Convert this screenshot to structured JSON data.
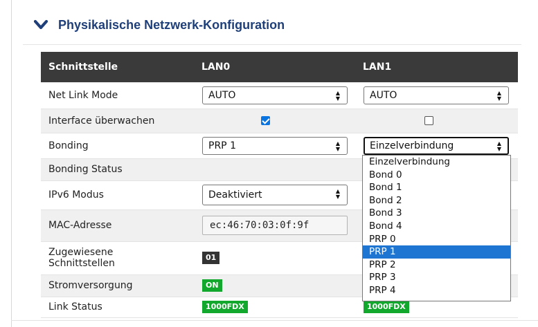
{
  "section": {
    "title": "Physikalische Netzwerk-Konfiguration"
  },
  "table": {
    "headers": [
      "Schnittstelle",
      "LAN0",
      "LAN1"
    ],
    "rows": {
      "net_link_mode": {
        "label": "Net Link Mode",
        "lan0": "AUTO",
        "lan1": "AUTO"
      },
      "interface_ueberwachen": {
        "label": "Interface überwachen",
        "lan0_checked": true,
        "lan1_checked": false
      },
      "bonding": {
        "label": "Bonding",
        "lan0": "PRP 1",
        "lan1": "Einzelverbindung"
      },
      "bonding_status": {
        "label": "Bonding Status"
      },
      "ipv6_modus": {
        "label": "IPv6 Modus",
        "lan0": "Deaktiviert"
      },
      "mac_adresse": {
        "label": "MAC-Adresse",
        "lan0": "ec:46:70:03:0f:9f"
      },
      "zugewiesene": {
        "label_line1": "Zugewiesene",
        "label_line2": "Schnittstellen",
        "lan0": "01"
      },
      "stromversorgung": {
        "label": "Stromversorgung",
        "lan0": "ON"
      },
      "link_status": {
        "label": "Link Status",
        "lan0": "1000FDX",
        "lan1": "1000FDX"
      }
    }
  },
  "dropdown": {
    "options": [
      "Einzelverbindung",
      "Bond 0",
      "Bond 1",
      "Bond 2",
      "Bond 3",
      "Bond 4",
      "PRP 0",
      "PRP 1",
      "PRP 2",
      "PRP 3",
      "PRP 4"
    ],
    "highlighted": "PRP 1"
  },
  "colors": {
    "title": "#1f3f7a",
    "header_bg": "#3a3a3a",
    "badge_green": "#12a82d",
    "highlight": "#1e76d2"
  }
}
